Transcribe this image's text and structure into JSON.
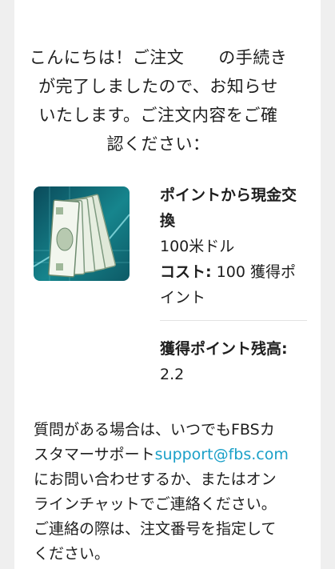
{
  "intro": {
    "line1": "こんにちは！ご注文　　の手続き",
    "line2": "が完了しましたので、お知らせ",
    "line3": "いたします。ご注文内容をご確",
    "line4": "認ください："
  },
  "product": {
    "image_icon": "dollar-bills-icon",
    "name_line1": "ポイントから現金交",
    "name_line2": "換",
    "amount": "100米ドル",
    "cost_label": "コスト:",
    "cost_line1": " 100 獲得ポ",
    "cost_line2": "イント"
  },
  "balance": {
    "label": "獲得ポイント残高:",
    "value": "2.2"
  },
  "support": {
    "line1": "質問がある場合は、いつでもFBSカ",
    "line2_prefix": "スタマーサポート",
    "email": "support@fbs.com",
    "line3": "にお問い合わせするか、またはオン",
    "line4": "ラインチャットでご連絡ください。",
    "line5": "ご連絡の際は、注文番号を指定して",
    "line6": "ください。"
  },
  "colors": {
    "link": "#1aa0c8",
    "card_background": "#ffffff",
    "page_background": "#efefef"
  }
}
